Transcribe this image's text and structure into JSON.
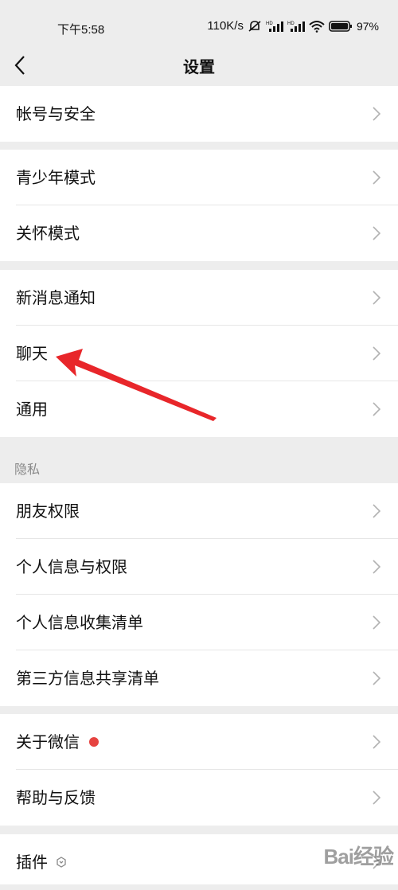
{
  "status_bar": {
    "time": "下午5:58",
    "speed": "110K/s",
    "battery": "97%"
  },
  "nav": {
    "title": "设置"
  },
  "groups": [
    {
      "items": [
        {
          "label": "帐号与安全"
        }
      ]
    },
    {
      "items": [
        {
          "label": "青少年模式"
        },
        {
          "label": "关怀模式"
        }
      ]
    },
    {
      "items": [
        {
          "label": "新消息通知"
        },
        {
          "label": "聊天"
        },
        {
          "label": "通用"
        }
      ]
    },
    {
      "section_label": "隐私",
      "items": [
        {
          "label": "朋友权限"
        },
        {
          "label": "个人信息与权限"
        },
        {
          "label": "个人信息收集清单"
        },
        {
          "label": "第三方信息共享清单"
        }
      ]
    },
    {
      "items": [
        {
          "label": "关于微信",
          "badge": "red-dot"
        },
        {
          "label": "帮助与反馈"
        }
      ]
    },
    {
      "items": [
        {
          "label": "插件",
          "icon": "plugin-icon"
        }
      ]
    }
  ],
  "annotation": {
    "type": "red-arrow",
    "color": "#e8262a",
    "points_to": "聊天"
  },
  "watermark": "Bai经验",
  "colors": {
    "background": "#ededed",
    "badge": "#e64340"
  }
}
